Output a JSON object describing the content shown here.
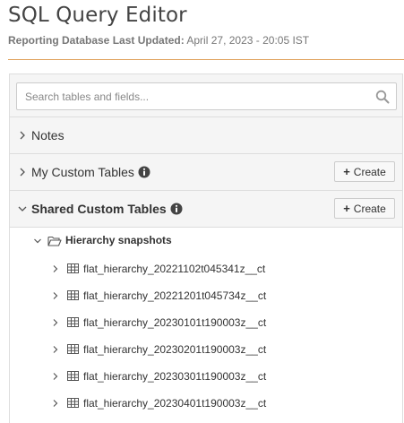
{
  "header": {
    "title": "SQL Query Editor",
    "updated_label": "Reporting Database Last Updated:",
    "updated_value": "April 27, 2023 - 20:05 IST"
  },
  "search": {
    "placeholder": "Search tables and fields...",
    "icon": "search-icon"
  },
  "sections": {
    "notes": {
      "label": "Notes",
      "expanded": false
    },
    "my_custom": {
      "label": "My Custom Tables",
      "expanded": false,
      "create_label": "Create"
    },
    "shared_custom": {
      "label": "Shared Custom Tables",
      "expanded": true,
      "create_label": "Create"
    }
  },
  "tree": {
    "folder": {
      "label": "Hierarchy snapshots",
      "expanded": true
    },
    "tables": [
      "flat_hierarchy_20221102t045341z__ct",
      "flat_hierarchy_20221201t045734z__ct",
      "flat_hierarchy_20230101t190003z__ct",
      "flat_hierarchy_20230201t190003z__ct",
      "flat_hierarchy_20230301t190003z__ct",
      "flat_hierarchy_20230401t190003z__ct"
    ]
  },
  "colors": {
    "accent_rule": "#e0a15a",
    "section_bg": "#f5f5f5",
    "border": "#dddddd"
  }
}
